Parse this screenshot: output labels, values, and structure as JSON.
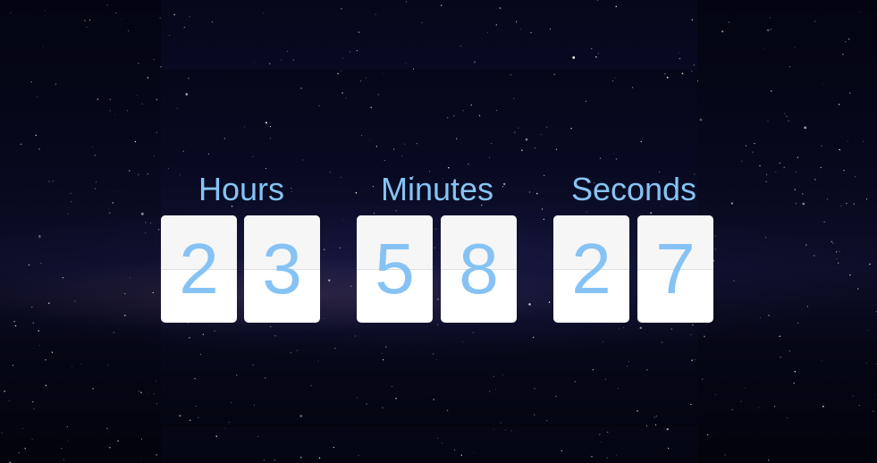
{
  "countdown": {
    "units": [
      {
        "label": "Hours",
        "digits": [
          "2",
          "3"
        ]
      },
      {
        "label": "Minutes",
        "digits": [
          "5",
          "8"
        ]
      },
      {
        "label": "Seconds",
        "digits": [
          "2",
          "7"
        ]
      }
    ]
  },
  "colors": {
    "accent": "#86c3f4",
    "card": "#ffffff",
    "card_top": "#f6f6f7",
    "background": "#05060d"
  }
}
